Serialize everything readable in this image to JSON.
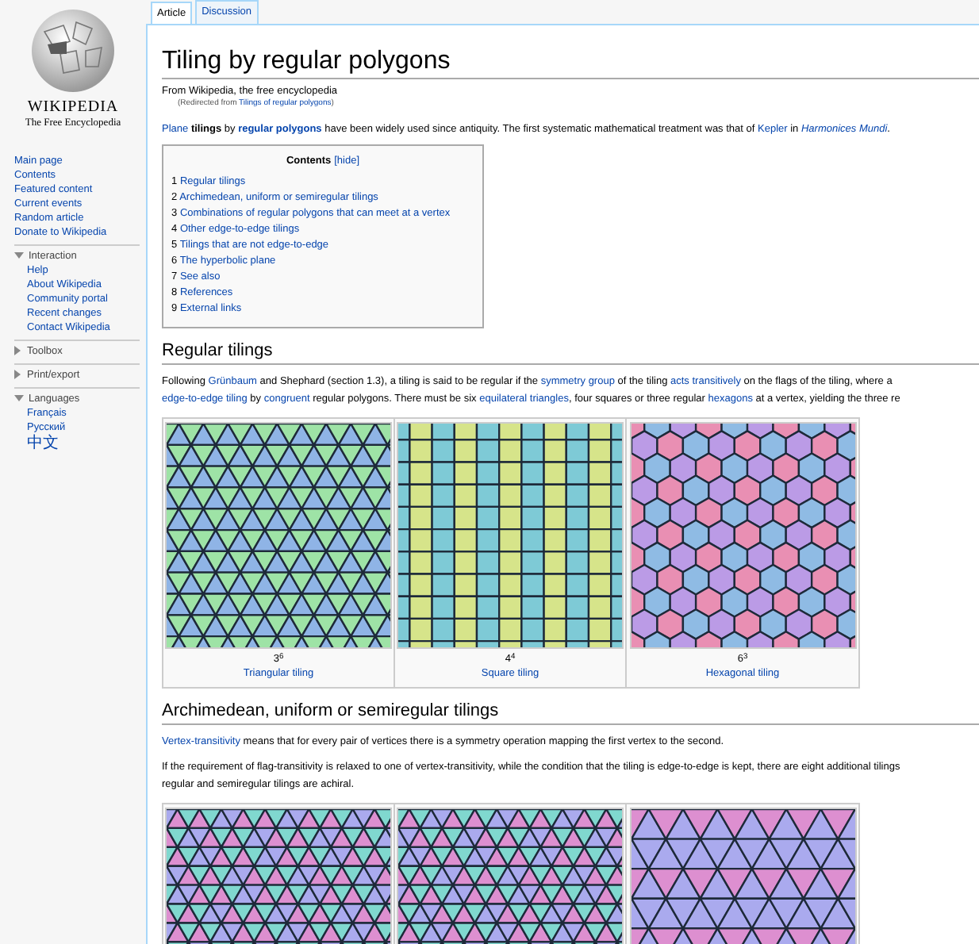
{
  "logo": {
    "wordmark": "WIKIPEDIA",
    "tagline": "The Free Encyclopedia"
  },
  "sidebar": {
    "navigation": [
      "Main page",
      "Contents",
      "Featured content",
      "Current events",
      "Random article",
      "Donate to Wikipedia"
    ],
    "portlets": [
      {
        "title": "Interaction",
        "expanded": true,
        "items": [
          "Help",
          "About Wikipedia",
          "Community portal",
          "Recent changes",
          "Contact Wikipedia"
        ]
      },
      {
        "title": "Toolbox",
        "expanded": false
      },
      {
        "title": "Print/export",
        "expanded": false
      },
      {
        "title": "Languages",
        "expanded": true,
        "items": [
          "Français",
          "Русский",
          "中文"
        ]
      }
    ]
  },
  "tabs": [
    {
      "label": "Article",
      "selected": true
    },
    {
      "label": "Discussion",
      "selected": false
    }
  ],
  "article": {
    "title": "Tiling by regular polygons",
    "tagline": "From Wikipedia, the free encyclopedia",
    "redirect": [
      {
        "kind": "plain",
        "text": "(Redirected from "
      },
      {
        "kind": "link",
        "text": "Tilings of regular polygons"
      },
      {
        "kind": "plain",
        "text": ")"
      }
    ],
    "intro": [
      {
        "kind": "link",
        "text": "Plane"
      },
      {
        "kind": "plain",
        "text": " **tilings** by "
      },
      {
        "kind": "link",
        "text": "**regular polygons**"
      },
      {
        "kind": "plain",
        "text": " have been widely used since antiquity. The first systematic mathematical treatment was that of "
      },
      {
        "kind": "link",
        "text": "Kepler"
      },
      {
        "kind": "plain",
        "text": " in "
      },
      {
        "kind": "link",
        "text": "*Harmonices Mundi*"
      },
      {
        "kind": "plain",
        "text": "."
      }
    ],
    "toc": {
      "title": "Contents",
      "toggle": "[hide]",
      "items": [
        {
          "number": "1",
          "label": "Regular tilings"
        },
        {
          "number": "2",
          "label": "Archimedean, uniform or semiregular tilings"
        },
        {
          "number": "3",
          "label": "Combinations of regular polygons that can meet at a vertex"
        },
        {
          "number": "4",
          "label": "Other edge-to-edge tilings"
        },
        {
          "number": "5",
          "label": "Tilings that are not edge-to-edge"
        },
        {
          "number": "6",
          "label": "The hyperbolic plane"
        },
        {
          "number": "7",
          "label": "See also"
        },
        {
          "number": "8",
          "label": "References"
        },
        {
          "number": "9",
          "label": "External links"
        }
      ]
    },
    "sections": [
      {
        "heading": "Regular tilings",
        "paragraphs": [
          [
            [
              {
                "kind": "plain",
                "text": "Following "
              },
              {
                "kind": "link",
                "text": "Grünbaum"
              },
              {
                "kind": "plain",
                "text": " and Shephard (section 1.3), a tiling is said to be regular if the "
              },
              {
                "kind": "link",
                "text": "symmetry group"
              },
              {
                "kind": "plain",
                "text": " of the tiling "
              },
              {
                "kind": "link",
                "text": "acts transitively"
              },
              {
                "kind": "plain",
                "text": " on the flags of the tiling, where a"
              }
            ],
            [
              {
                "kind": "link",
                "text": "edge-to-edge tiling"
              },
              {
                "kind": "plain",
                "text": " by "
              },
              {
                "kind": "link",
                "text": "congruent"
              },
              {
                "kind": "plain",
                "text": " regular polygons. There must be six "
              },
              {
                "kind": "link",
                "text": "equilateral triangles"
              },
              {
                "kind": "plain",
                "text": ", four squares or three regular "
              },
              {
                "kind": "link",
                "text": "hexagons"
              },
              {
                "kind": "plain",
                "text": " at a vertex, yielding the three re"
              }
            ]
          ]
        ],
        "gallery": [
          {
            "kind": "triangular",
            "notation": "3$^{6}$",
            "caption": "Triangular tiling"
          },
          {
            "kind": "square",
            "notation": "4$^{4}$",
            "caption": "Square tiling"
          },
          {
            "kind": "hexagonal",
            "notation": "6$^{3}$",
            "caption": "Hexagonal tiling"
          }
        ]
      },
      {
        "heading": "Archimedean, uniform or semiregular tilings",
        "paragraphs": [
          [
            [
              {
                "kind": "link",
                "text": "Vertex-transitivity"
              },
              {
                "kind": "plain",
                "text": " means that for every pair of vertices there is a symmetry operation mapping the first vertex to the second."
              }
            ]
          ],
          [
            [
              {
                "kind": "plain",
                "text": "If the requirement of flag-transitivity is relaxed to one of vertex-transitivity, while the condition that the tiling is edge-to-edge is kept, there are eight additional tilings"
              }
            ],
            [
              {
                "kind": "plain",
                "text": "regular and semiregular tilings are achiral."
              }
            ]
          ]
        ],
        "gallery": [
          {
            "kind": "snub-a"
          },
          {
            "kind": "snub-b"
          },
          {
            "kind": "trihexagonal"
          }
        ]
      }
    ]
  }
}
